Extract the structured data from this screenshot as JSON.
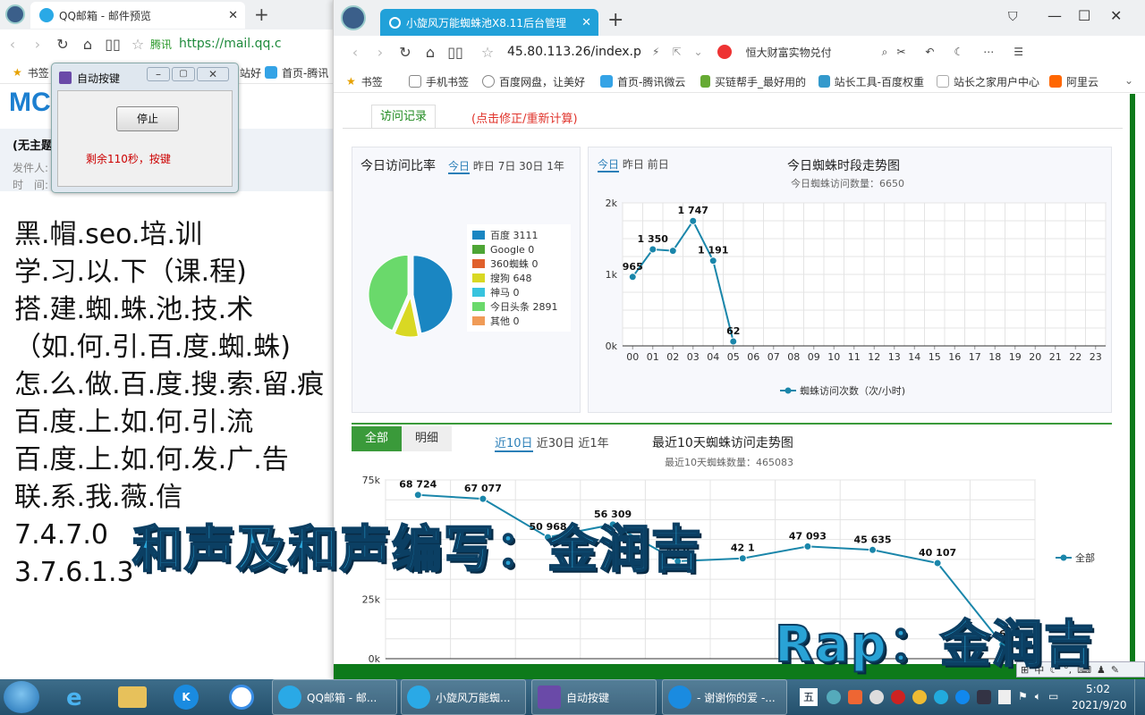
{
  "left_browser": {
    "tab_title": "QQ邮箱 - 邮件预览",
    "address": "https://mail.qq.c",
    "addr_label": "腾讯",
    "bookmarks": [
      "书签",
      "站好",
      "首页-腾讯"
    ],
    "mail_subject": "(无主题",
    "sender_label": "发件人:",
    "time_label": "时　间:"
  },
  "dialog": {
    "title": "自动按键",
    "stop_button": "停止",
    "status": "剩余110秒，按键"
  },
  "left_text": {
    "lines": [
      "黑.帽.seo.培.训",
      "学.习.以.下（课.程)",
      "搭.建.蜘.蛛.池.技.术",
      "（如.何.引.百.度.蜘.蛛)",
      "怎.么.做.百.度.搜.索.留.痕",
      "百.度.上.如.何.引.流",
      "百.度.上.如.何.发.广.告",
      "联.系.我.薇.信",
      "7.4.7.0",
      "3.7.6.1.3"
    ]
  },
  "right_browser": {
    "tab_title": "小旋风万能蜘蛛池X8.11后台管理",
    "address": "45.80.113.26/index.php",
    "search_hint": "恒大财富实物兑付",
    "bookmarks": [
      "书签",
      "手机书签",
      "百度网盘，让美好",
      "首页-腾讯微云",
      "买链帮手_最好用的",
      "站长工具-百度权重",
      "站长之家用户中心",
      "阿里云"
    ]
  },
  "page": {
    "tab_active": "访问记录",
    "tab_link": "(点击修正/重新计算)",
    "pie_panel": {
      "title": "今日访问比率",
      "ranges": [
        "今日",
        "昨日",
        "7日",
        "30日",
        "1年"
      ]
    },
    "hourly_panel": {
      "ranges": [
        "今日",
        "昨日",
        "前日"
      ],
      "title": "今日蜘蛛时段走势图",
      "subtitle": "今日蜘蛛访问数量：6650",
      "legend": "蜘蛛访问次数（次/小时)"
    },
    "ten_day_panel": {
      "tabs": [
        "全部",
        "明细"
      ],
      "ranges": [
        "近10日",
        "近30日",
        "近1年"
      ],
      "title": "最近10天蜘蛛访问走势图",
      "subtitle": "最近10天蜘蛛数量：465083",
      "legend": "全部"
    }
  },
  "chart_data": [
    {
      "type": "pie",
      "labels": [
        "百度",
        "Google",
        "360蜘蛛",
        "搜狗",
        "神马",
        "今日头条",
        "其他"
      ],
      "values": [
        3111,
        0,
        0,
        648,
        0,
        2891,
        0
      ],
      "colors": [
        "#1a86c2",
        "#4da535",
        "#e0602c",
        "#d9d823",
        "#37c3de",
        "#6ad96b",
        "#f09b57"
      ]
    },
    {
      "type": "line",
      "x": [
        "00",
        "01",
        "02",
        "03",
        "04",
        "05",
        "06",
        "07",
        "08",
        "09",
        "10",
        "11",
        "12",
        "13",
        "14",
        "15",
        "16",
        "17",
        "18",
        "19",
        "20",
        "21",
        "22",
        "23"
      ],
      "values": [
        965,
        1350,
        1330,
        1747,
        1191,
        62
      ],
      "labels": [
        "965",
        "1 350",
        "",
        "1 747",
        "1 191",
        "62"
      ],
      "yticks": [
        "0k",
        "1k",
        "2k"
      ],
      "ylim": [
        0,
        2000
      ],
      "color": "#1a86aa"
    },
    {
      "type": "line",
      "values": [
        68724,
        67077,
        50968,
        56309,
        40900,
        42100,
        47093,
        45635,
        40107,
        6000
      ],
      "labels": [
        "68 724",
        "67 077",
        "50 968",
        "56 309",
        "40 9",
        "42 1",
        "47 093",
        "45 635",
        "40 107",
        "6"
      ],
      "yticks": [
        "0k",
        "25k",
        "50k",
        "75k"
      ],
      "ylim": [
        0,
        75000
      ],
      "color": "#1a86aa"
    }
  ],
  "overlays": {
    "line1": "和声及和声编写：金润吉",
    "line2": "Rap：金润吉"
  },
  "taskbar": {
    "items": [
      "QQ邮箱 - 邮...",
      "小旋风万能蜘...",
      "自动按键",
      "- 谢谢你的爱 -..."
    ],
    "time": "5:02",
    "date": "2021/9/20",
    "ime": "五",
    "ime_bar": "中"
  }
}
